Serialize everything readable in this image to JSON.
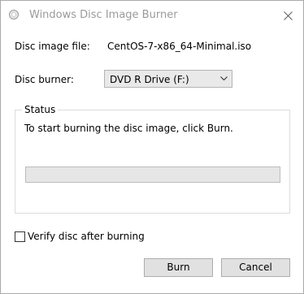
{
  "window": {
    "title": "Windows Disc Image Burner"
  },
  "fields": {
    "disc_image_label": "Disc image file:",
    "disc_image_value": "CentOS-7-x86_64-Minimal.iso",
    "disc_burner_label": "Disc burner:",
    "disc_burner_selected": "DVD R Drive (F:)"
  },
  "status": {
    "caption": "Status",
    "message": "To start burning the disc image, click Burn.",
    "progress_fraction": 0
  },
  "options": {
    "verify_label": "Verify disc after burning",
    "verify_checked": false
  },
  "buttons": {
    "burn_label": "Burn",
    "cancel_label": "Cancel"
  },
  "colors": {
    "progress_fill": "#06b025",
    "title_text": "#9a9a9a"
  },
  "icons": {
    "title_icon": "disc-icon",
    "close_icon": "close-icon",
    "dropdown_icon": "chevron-down-icon"
  }
}
